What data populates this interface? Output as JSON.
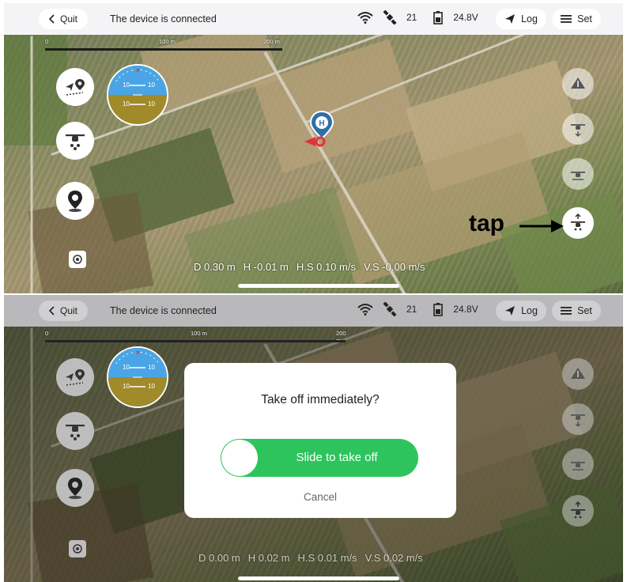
{
  "colors": {
    "topbar_bg": "#f4f4f6",
    "accent_green": "#2ec45d",
    "attitude_sky": "#4aa5e6",
    "attitude_ground": "#a08a2a",
    "marker_blue": "#2f6fa8",
    "marker_red": "#e0343a"
  },
  "top": {
    "topbar": {
      "quit_label": "Quit",
      "connection_status": "The device is connected",
      "satellite_count": "21",
      "battery_voltage": "24.8V",
      "log_label": "Log",
      "set_label": "Set"
    },
    "scale": {
      "tick_0": "0",
      "tick_100": "100 m",
      "tick_200": "200 m"
    },
    "attitude": {
      "upper_left": "10",
      "upper_right": "10",
      "lower_left": "10",
      "lower_right": "10"
    },
    "telemetry": {
      "distance": "D 0.30 m",
      "height": "H -0.01 m",
      "horizontal_speed": "H.S 0.10 m/s",
      "vertical_speed": "V.S -0.00 m/s"
    },
    "annotation": "tap"
  },
  "bottom": {
    "topbar": {
      "quit_label": "Quit",
      "connection_status": "The device is connected",
      "satellite_count": "21",
      "battery_voltage": "24.8V",
      "log_label": "Log",
      "set_label": "Set"
    },
    "scale": {
      "tick_0": "0",
      "tick_100": "100 m",
      "tick_200": "200 m"
    },
    "attitude": {
      "upper_left": "10",
      "upper_right": "10",
      "lower_left": "10",
      "lower_right": "10"
    },
    "telemetry": {
      "distance": "D 0.00 m",
      "height": "H 0.02 m",
      "horizontal_speed": "H.S 0.01 m/s",
      "vertical_speed": "V.S 0.02 m/s"
    },
    "dialog": {
      "title": "Take off immediately?",
      "slider_label": "Slide to take off",
      "cancel_label": "Cancel"
    }
  },
  "icons": {
    "back": "chevron-left-icon",
    "wifi": "wifi-icon",
    "satellite": "satellite-icon",
    "battery": "battery-icon",
    "log": "send-arrow-icon",
    "set": "menu-icon",
    "route": "route-icon",
    "drone": "drone-icon",
    "location": "location-pin-icon",
    "locate": "target-icon",
    "home": "home-marker-icon",
    "takeoff": "takeoff-icon",
    "land": "land-icon",
    "return": "return-home-icon"
  }
}
